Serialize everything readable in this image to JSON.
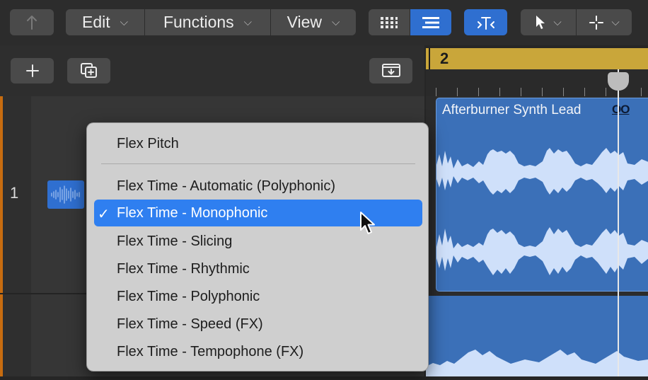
{
  "toolbar": {
    "edit_label": "Edit",
    "functions_label": "Functions",
    "view_label": "View"
  },
  "track": {
    "number": "1"
  },
  "ruler": {
    "bar_label": "2"
  },
  "region": {
    "name": "Afterburner Synth Lead",
    "flex_indicator": "OO"
  },
  "flex_menu": {
    "items": [
      {
        "label": "Flex Pitch",
        "selected": false
      },
      {
        "label": "Flex Time - Automatic (Polyphonic)",
        "selected": false
      },
      {
        "label": "Flex Time - Monophonic",
        "selected": true
      },
      {
        "label": "Flex Time - Slicing",
        "selected": false
      },
      {
        "label": "Flex Time - Rhythmic",
        "selected": false
      },
      {
        "label": "Flex Time - Polyphonic",
        "selected": false
      },
      {
        "label": "Flex Time - Speed (FX)",
        "selected": false
      },
      {
        "label": "Flex Time - Tempophone (FX)",
        "selected": false
      }
    ],
    "check_glyph": "✓"
  },
  "colors": {
    "accent": "#2f7ff0",
    "region": "#3b70b8",
    "ruler": "#c9a63a",
    "track": "#c76c10"
  }
}
